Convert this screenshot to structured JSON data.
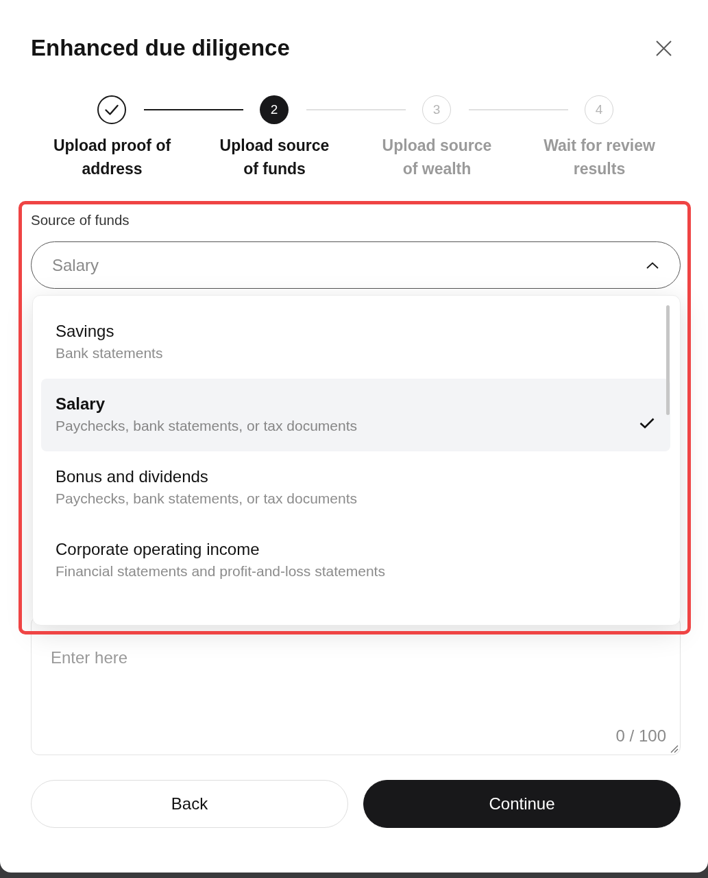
{
  "dialog": {
    "title": "Enhanced due diligence"
  },
  "steps": [
    {
      "label": "Upload proof of address",
      "completed": true,
      "selected": false
    },
    {
      "label": "Upload source of funds",
      "number": "2",
      "completed": false,
      "selected": true
    },
    {
      "label": "Upload source of wealth",
      "number": "3",
      "completed": false,
      "selected": false
    },
    {
      "label": "Wait for review results",
      "number": "4",
      "completed": false,
      "selected": false
    }
  ],
  "source_of_funds": {
    "label": "Source of funds",
    "value": "Salary",
    "expanded": true,
    "highlighted": true,
    "options": [
      {
        "title": "Savings",
        "description": "Bank statements",
        "selected": false
      },
      {
        "title": "Salary",
        "description": "Paychecks, bank statements, or tax documents",
        "selected": true
      },
      {
        "title": "Bonus and dividends",
        "description": "Paychecks, bank statements, or tax documents",
        "selected": false
      },
      {
        "title": "Corporate operating income",
        "description": "Financial statements and profit-and-loss statements",
        "selected": false
      }
    ]
  },
  "details": {
    "placeholder": "Enter here",
    "counter": "0 / 100"
  },
  "buttons": [
    {
      "label": "Back",
      "kind": "secondary"
    },
    {
      "label": "Continue",
      "kind": "primary"
    }
  ]
}
